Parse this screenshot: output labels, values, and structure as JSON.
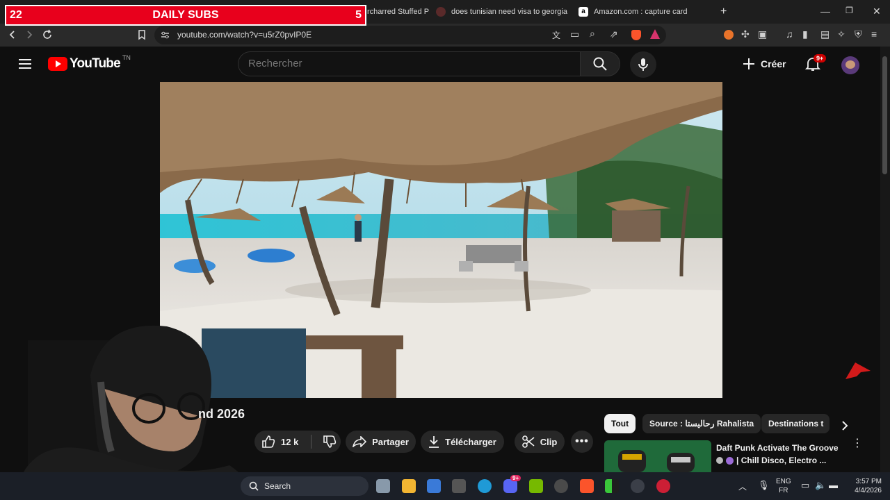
{
  "overlay": {
    "left_count": "22",
    "label": "DAILY SUBS",
    "right_count": "5"
  },
  "browser": {
    "tabs": [
      {
        "title": "rcharred Stuffed P"
      },
      {
        "title": "does tunisian need visa to georgia - ",
        "favicon": "search-favicon"
      },
      {
        "title": "Amazon.com : capture card",
        "favicon": "amazon-favicon"
      }
    ],
    "url": "youtube.com/watch?v=u5rZ0pvIP0E"
  },
  "youtube": {
    "logo": "YouTube",
    "region": "TN",
    "search_placeholder": "Rechercher",
    "create_label": "Créer",
    "notif_badge": "9+",
    "video_title_fragment": "nd 2026",
    "actions": {
      "like_count": "12 k",
      "share": "Partager",
      "download": "Télécharger",
      "clip": "Clip"
    },
    "chips": [
      "Tout",
      "Source : رحاليستا Rahalista",
      "Destinations t"
    ],
    "recommended": {
      "title_line1": "Daft Punk Activate The Groove",
      "title_line2": "| Chill Disco, Electro ..."
    }
  },
  "taskbar": {
    "search_label": "Search",
    "lang_top": "ENG",
    "lang_bottom": "FR",
    "time": "3:57 PM",
    "date": "4/4/2026",
    "discord_badge": "9+"
  },
  "colors": {
    "brand_red": "#ff0000",
    "overlay_red": "#e8001c",
    "bg": "#0f0f0f"
  }
}
